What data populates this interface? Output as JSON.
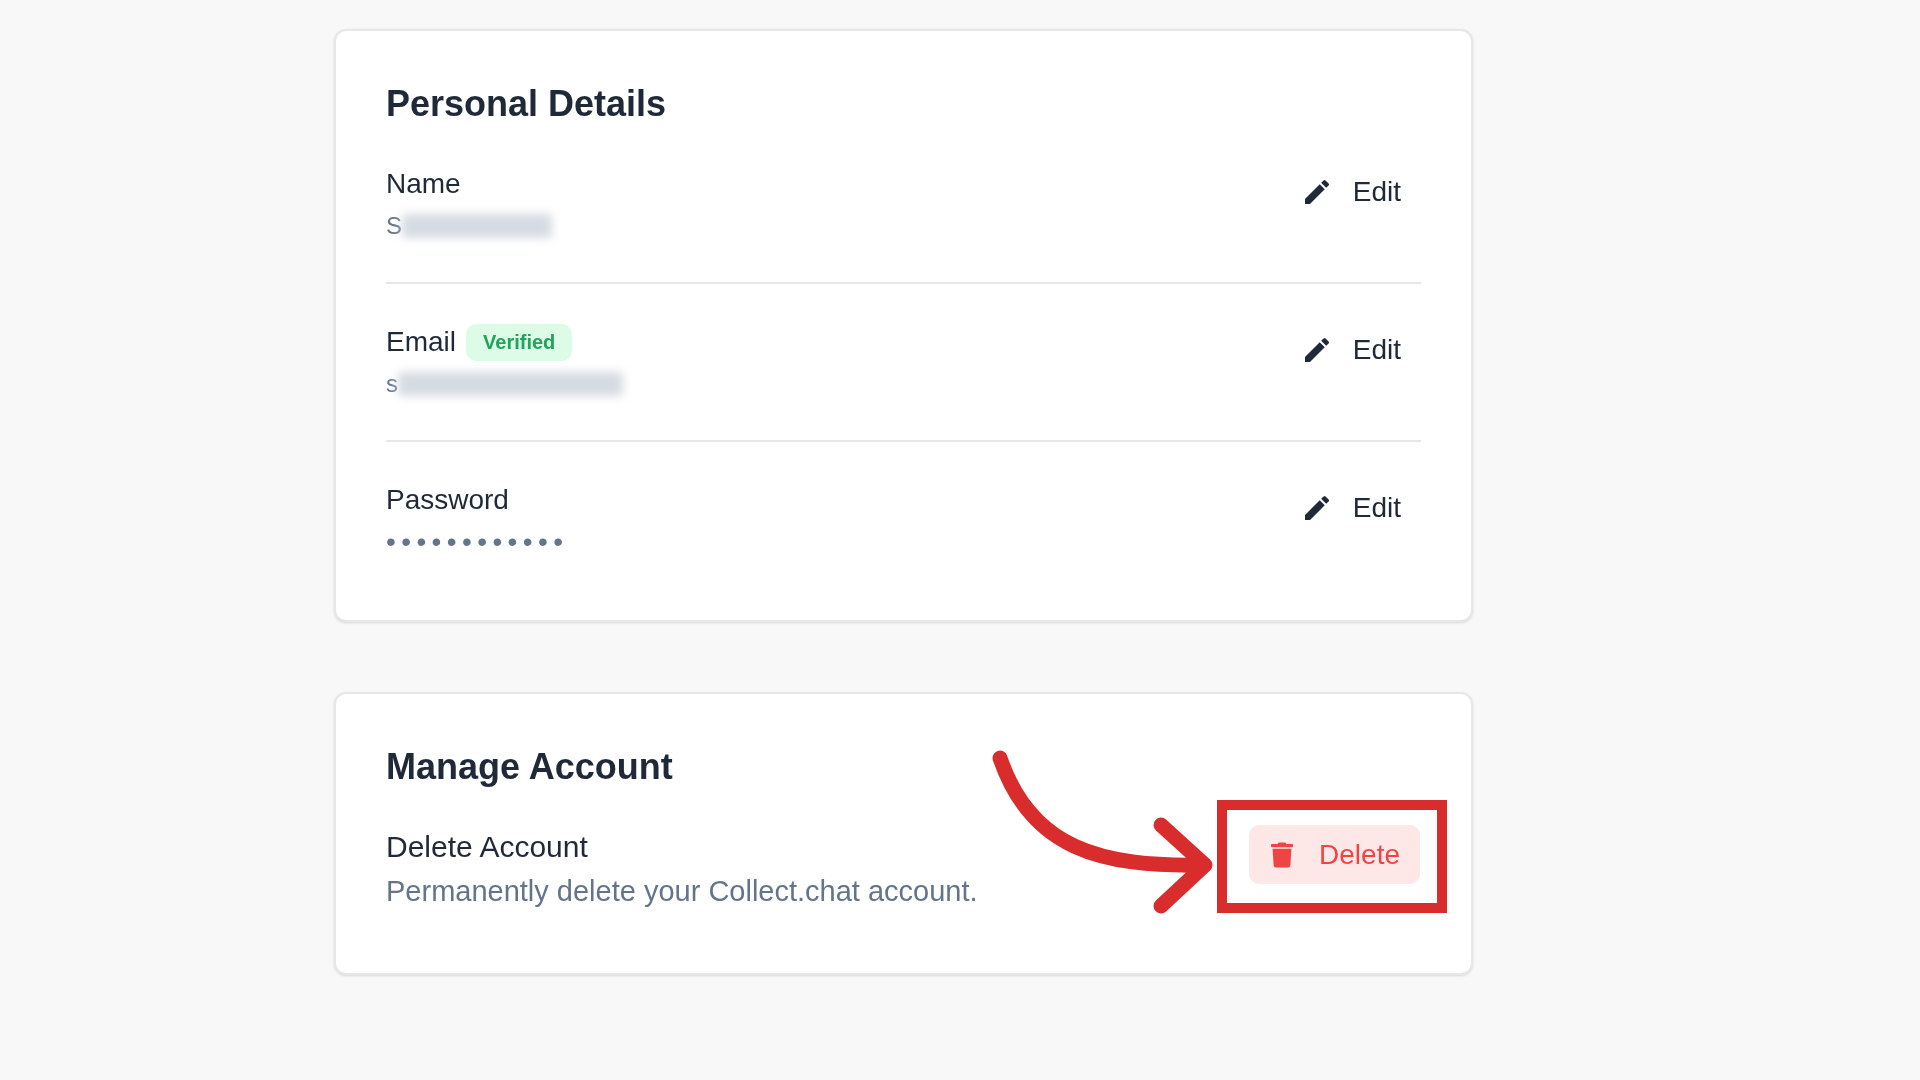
{
  "personal_details": {
    "title": "Personal Details",
    "fields": [
      {
        "label": "Name",
        "value": "S",
        "redacted": true,
        "action": "Edit"
      },
      {
        "label": "Email",
        "badge": "Verified",
        "value": "s",
        "redacted": true,
        "action": "Edit"
      },
      {
        "label": "Password",
        "value": "••••••••••••",
        "redacted": false,
        "action": "Edit"
      }
    ]
  },
  "manage_account": {
    "title": "Manage Account",
    "item": {
      "label": "Delete Account",
      "description": "Permanently delete your Collect.chat account.",
      "button": "Delete",
      "highlighted": true
    }
  }
}
